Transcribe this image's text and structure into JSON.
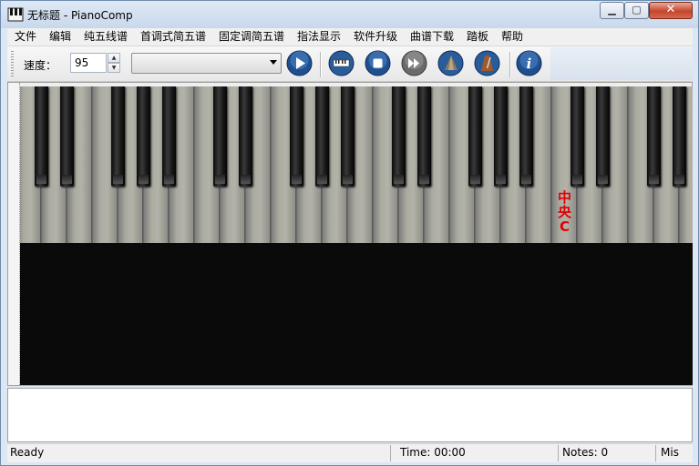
{
  "window": {
    "title": "无标题 - PianoComp",
    "minimize_glyph": "▁",
    "maximize_glyph": "▢",
    "close_glyph": "✕"
  },
  "menu": {
    "items": [
      "文件",
      "编辑",
      "纯五线谱",
      "首调式简五谱",
      "固定调简五谱",
      "指法显示",
      "软件升级",
      "曲谱下载",
      "踏板",
      "帮助"
    ]
  },
  "toolbar": {
    "speed_label": "速度：",
    "speed_value": "95",
    "spin_up_glyph": "▲",
    "spin_down_glyph": "▼",
    "song_select_value": "",
    "buttons": [
      {
        "name": "play-icon"
      },
      {
        "name": "keyboard-icon"
      },
      {
        "name": "stop-icon"
      },
      {
        "name": "fast-forward-icon"
      },
      {
        "name": "cone-icon"
      },
      {
        "name": "metronome-icon"
      },
      {
        "name": "info-icon"
      }
    ]
  },
  "piano": {
    "middle_c_label": [
      "中",
      "央",
      "C"
    ]
  },
  "status": {
    "ready": "Ready",
    "time": "Time: 00:00",
    "notes": "Notes: 0",
    "misc": "Mis"
  }
}
